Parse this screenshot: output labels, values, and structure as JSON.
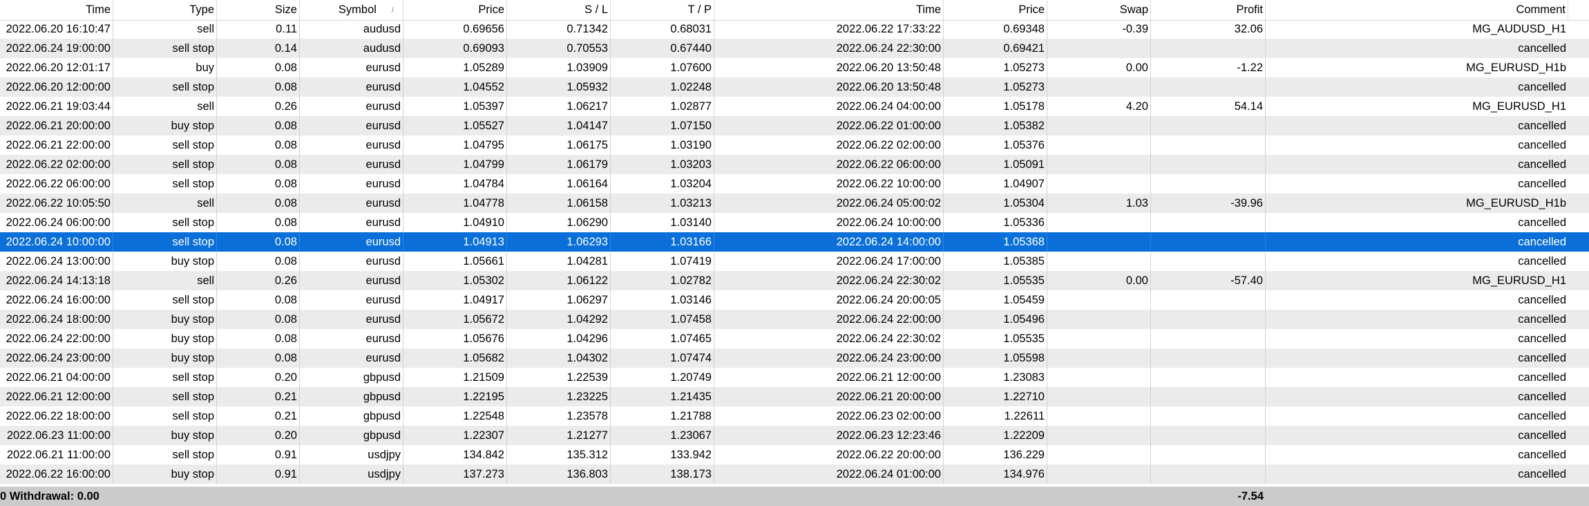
{
  "columns": [
    "Time",
    "Type",
    "Size",
    "Symbol",
    "Price",
    "S / L",
    "T / P",
    "Time",
    "Price",
    "Swap",
    "Profit",
    "Comment"
  ],
  "sort_indicator": "/",
  "selected_row": 11,
  "rows": [
    [
      "2022.06.20 16:10:47",
      "sell",
      "0.11",
      "audusd",
      "0.69656",
      "0.71342",
      "0.68031",
      "2022.06.22 17:33:22",
      "0.69348",
      "-0.39",
      "32.06",
      "MG_AUDUSD_H1"
    ],
    [
      "2022.06.24 19:00:00",
      "sell stop",
      "0.14",
      "audusd",
      "0.69093",
      "0.70553",
      "0.67440",
      "2022.06.24 22:30:00",
      "0.69421",
      "",
      "",
      "cancelled"
    ],
    [
      "2022.06.20 12:01:17",
      "buy",
      "0.08",
      "eurusd",
      "1.05289",
      "1.03909",
      "1.07600",
      "2022.06.20 13:50:48",
      "1.05273",
      "0.00",
      "-1.22",
      "MG_EURUSD_H1b"
    ],
    [
      "2022.06.20 12:00:00",
      "sell stop",
      "0.08",
      "eurusd",
      "1.04552",
      "1.05932",
      "1.02248",
      "2022.06.20 13:50:48",
      "1.05273",
      "",
      "",
      "cancelled"
    ],
    [
      "2022.06.21 19:03:44",
      "sell",
      "0.26",
      "eurusd",
      "1.05397",
      "1.06217",
      "1.02877",
      "2022.06.24 04:00:00",
      "1.05178",
      "4.20",
      "54.14",
      "MG_EURUSD_H1"
    ],
    [
      "2022.06.21 20:00:00",
      "buy stop",
      "0.08",
      "eurusd",
      "1.05527",
      "1.04147",
      "1.07150",
      "2022.06.22 01:00:00",
      "1.05382",
      "",
      "",
      "cancelled"
    ],
    [
      "2022.06.21 22:00:00",
      "sell stop",
      "0.08",
      "eurusd",
      "1.04795",
      "1.06175",
      "1.03190",
      "2022.06.22 02:00:00",
      "1.05376",
      "",
      "",
      "cancelled"
    ],
    [
      "2022.06.22 02:00:00",
      "sell stop",
      "0.08",
      "eurusd",
      "1.04799",
      "1.06179",
      "1.03203",
      "2022.06.22 06:00:00",
      "1.05091",
      "",
      "",
      "cancelled"
    ],
    [
      "2022.06.22 06:00:00",
      "sell stop",
      "0.08",
      "eurusd",
      "1.04784",
      "1.06164",
      "1.03204",
      "2022.06.22 10:00:00",
      "1.04907",
      "",
      "",
      "cancelled"
    ],
    [
      "2022.06.22 10:05:50",
      "sell",
      "0.08",
      "eurusd",
      "1.04778",
      "1.06158",
      "1.03213",
      "2022.06.24 05:00:02",
      "1.05304",
      "1.03",
      "-39.96",
      "MG_EURUSD_H1b"
    ],
    [
      "2022.06.24 06:00:00",
      "sell stop",
      "0.08",
      "eurusd",
      "1.04910",
      "1.06290",
      "1.03140",
      "2022.06.24 10:00:00",
      "1.05336",
      "",
      "",
      "cancelled"
    ],
    [
      "2022.06.24 10:00:00",
      "sell stop",
      "0.08",
      "eurusd",
      "1.04913",
      "1.06293",
      "1.03166",
      "2022.06.24 14:00:00",
      "1.05368",
      "",
      "",
      "cancelled"
    ],
    [
      "2022.06.24 13:00:00",
      "buy stop",
      "0.08",
      "eurusd",
      "1.05661",
      "1.04281",
      "1.07419",
      "2022.06.24 17:00:00",
      "1.05385",
      "",
      "",
      "cancelled"
    ],
    [
      "2022.06.24 14:13:18",
      "sell",
      "0.26",
      "eurusd",
      "1.05302",
      "1.06122",
      "1.02782",
      "2022.06.24 22:30:02",
      "1.05535",
      "0.00",
      "-57.40",
      "MG_EURUSD_H1"
    ],
    [
      "2022.06.24 16:00:00",
      "sell stop",
      "0.08",
      "eurusd",
      "1.04917",
      "1.06297",
      "1.03146",
      "2022.06.24 20:00:05",
      "1.05459",
      "",
      "",
      "cancelled"
    ],
    [
      "2022.06.24 18:00:00",
      "buy stop",
      "0.08",
      "eurusd",
      "1.05672",
      "1.04292",
      "1.07458",
      "2022.06.24 22:00:00",
      "1.05496",
      "",
      "",
      "cancelled"
    ],
    [
      "2022.06.24 22:00:00",
      "buy stop",
      "0.08",
      "eurusd",
      "1.05676",
      "1.04296",
      "1.07465",
      "2022.06.24 22:30:02",
      "1.05535",
      "",
      "",
      "cancelled"
    ],
    [
      "2022.06.24 23:00:00",
      "buy stop",
      "0.08",
      "eurusd",
      "1.05682",
      "1.04302",
      "1.07474",
      "2022.06.24 23:00:00",
      "1.05598",
      "",
      "",
      "cancelled"
    ],
    [
      "2022.06.21 04:00:00",
      "sell stop",
      "0.20",
      "gbpusd",
      "1.21509",
      "1.22539",
      "1.20749",
      "2022.06.21 12:00:00",
      "1.23083",
      "",
      "",
      "cancelled"
    ],
    [
      "2022.06.21 12:00:00",
      "sell stop",
      "0.21",
      "gbpusd",
      "1.22195",
      "1.23225",
      "1.21435",
      "2022.06.21 20:00:00",
      "1.22710",
      "",
      "",
      "cancelled"
    ],
    [
      "2022.06.22 18:00:00",
      "sell stop",
      "0.21",
      "gbpusd",
      "1.22548",
      "1.23578",
      "1.21788",
      "2022.06.23 02:00:00",
      "1.22611",
      "",
      "",
      "cancelled"
    ],
    [
      "2022.06.23 11:00:00",
      "buy stop",
      "0.20",
      "gbpusd",
      "1.22307",
      "1.21277",
      "1.23067",
      "2022.06.23 12:23:46",
      "1.22209",
      "",
      "",
      "cancelled"
    ],
    [
      "2022.06.21 11:00:00",
      "sell stop",
      "0.91",
      "usdjpy",
      "134.842",
      "135.312",
      "133.942",
      "2022.06.22 20:00:00",
      "136.229",
      "",
      "",
      "cancelled"
    ],
    [
      "2022.06.22 16:00:00",
      "buy stop",
      "0.91",
      "usdjpy",
      "137.273",
      "136.803",
      "138.173",
      "2022.06.24 01:00:00",
      "134.976",
      "",
      "",
      "cancelled"
    ]
  ],
  "footer": {
    "withdrawal_text": "0  Withdrawal: 0.00",
    "total_profit": "-7.54"
  },
  "colors": {
    "selection": "#0a6fd8",
    "alt_row": "#ebebeb",
    "footer_bg": "#cbcbcb"
  }
}
